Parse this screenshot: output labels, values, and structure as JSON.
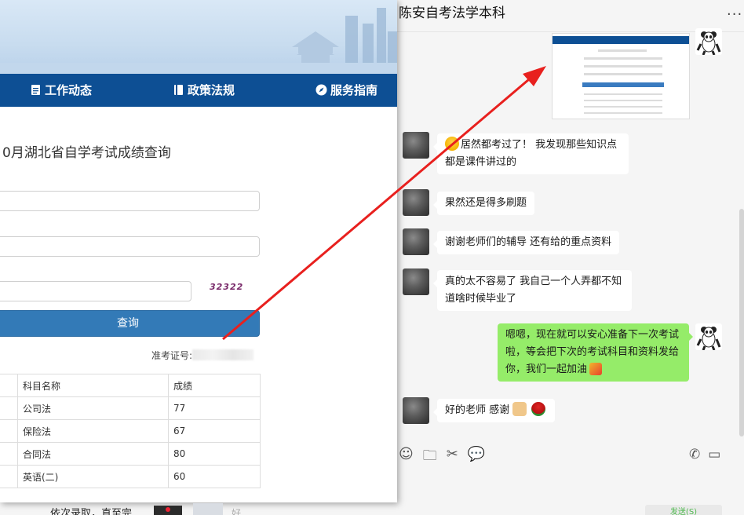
{
  "chat": {
    "title": "陈安自考法学本科",
    "more": "···",
    "messages": [
      {
        "side": "other",
        "emoji": "laugh-cry-emoji",
        "text": "居然都考过了！ 我发现那些知识点都是课件讲过的"
      },
      {
        "side": "other",
        "text": "果然还是得多刷题"
      },
      {
        "side": "other",
        "text": "谢谢老师们的辅导 还有给的重点资料"
      },
      {
        "side": "other",
        "text": "真的太不容易了 我自己一个人弄都不知道啥时候毕业了"
      },
      {
        "side": "me",
        "text": "嗯嗯，现在就可以安心准备下一次考试啦，等会把下次的考试科目和资料发给你，我们一起加油",
        "emoji": "party-popper-emoji"
      },
      {
        "side": "other",
        "text": "好的老师 感谢",
        "emojis": [
          "pray-emoji",
          "rose-emoji"
        ]
      }
    ],
    "toolbar": [
      "emoji-icon",
      "folder-icon",
      "scissors-icon",
      "chat-bubble-icon",
      "phone-icon",
      "video-icon"
    ],
    "bottom_hint": "发送(S)"
  },
  "web": {
    "nav": [
      {
        "label": "工作动态",
        "icon": "document-icon"
      },
      {
        "label": "政策法规",
        "icon": "book-icon"
      },
      {
        "label": "服务指南",
        "icon": "compass-icon"
      }
    ],
    "page_title": "0月湖北省自学考试成绩查询",
    "captcha": "32322",
    "query_button": "查询",
    "ticket_label": "准考证号:",
    "table": {
      "headers": [
        "",
        "科目名称",
        "成绩"
      ],
      "rows": [
        [
          "",
          "公司法",
          "77"
        ],
        [
          "",
          "保险法",
          "67"
        ],
        [
          "",
          "合同法",
          "80"
        ],
        [
          "",
          "英语(二)",
          "60"
        ]
      ]
    },
    "below_text": "依次录取，直至完",
    "below_text2": "好"
  },
  "colors": {
    "nav_blue": "#0d4f94",
    "button_blue": "#337ab7",
    "chat_green": "#95ec69",
    "arrow_red": "#e8201e"
  }
}
